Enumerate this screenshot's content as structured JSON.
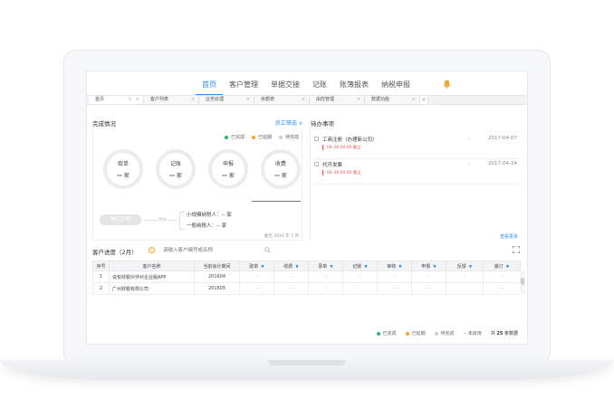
{
  "nav": {
    "items": [
      {
        "label": "首页",
        "active": true
      },
      {
        "label": "客户管理",
        "active": false
      },
      {
        "label": "单据交接",
        "active": false
      },
      {
        "label": "记账",
        "active": false
      },
      {
        "label": "账簿报表",
        "active": false
      },
      {
        "label": "纳税申报",
        "active": false
      }
    ],
    "bell_icon": "bell-icon"
  },
  "tabs": [
    {
      "label": "首页",
      "active": true
    },
    {
      "label": "客户列表",
      "active": false
    },
    {
      "label": "业务处理",
      "active": false
    },
    {
      "label": "余额表",
      "active": false
    },
    {
      "label": "由控管理",
      "active": false
    },
    {
      "label": "数据功能",
      "active": false
    }
  ],
  "overview": {
    "title": "完成情况",
    "staff_filter": "员工筛选 ∨",
    "legend": [
      {
        "label": "已完成",
        "color": "#2bbb5c"
      },
      {
        "label": "已延期",
        "color": "#f5a623"
      },
      {
        "label": "待完成",
        "color": "#cfcfcf"
      }
    ],
    "rings": [
      {
        "label": "取单",
        "value": "--",
        "unit": "家"
      },
      {
        "label": "记账",
        "value": "--",
        "unit": "家"
      },
      {
        "label": "申报",
        "value": "--",
        "unit": "家"
      },
      {
        "label": "收费",
        "value": "--",
        "unit": "家"
      }
    ],
    "start_button": "做完出账",
    "connector_label": "待办",
    "small_taxpayer": "小规模纳税人：-- 家",
    "general_taxpayer": "一般纳税人：-- 家",
    "as_of": "截至 2016 年 2 月"
  },
  "todo": {
    "title": "待办事项",
    "items": [
      {
        "name": "工商注册（办理新公司）",
        "date": "2017-04-07",
        "deadline": "04-28 00:00 截止"
      },
      {
        "name": "代开发票",
        "date": "2017-04-24",
        "deadline": "04-28 00:00 截止"
      }
    ],
    "view_more": "查看更多"
  },
  "progress": {
    "title": "客户进度（2月）",
    "search_placeholder": "请输入客户编号或名称",
    "columns": [
      "序号",
      "客户名称",
      "当前会计期间",
      "取单",
      "收费",
      "录单",
      "记账",
      "审核",
      "申报",
      "反馈",
      "装订"
    ],
    "rows": [
      {
        "no": "1",
        "name": "说有财税伙伴对企业版APP",
        "period": "201604",
        "cells": [
          "--",
          "--",
          "--",
          "--",
          "--",
          "--",
          "--",
          "--"
        ]
      },
      {
        "no": "2",
        "name": "广州财税有限公司",
        "period": "201605",
        "cells": [
          "--",
          "--",
          "--",
          "--",
          "--",
          "--",
          "--",
          "--"
        ]
      }
    ],
    "legend": [
      {
        "label": "已完成",
        "color": "#2bbb5c"
      },
      {
        "label": "已延期",
        "color": "#f5a623"
      },
      {
        "label": "待完成",
        "color": "#cfcfcf"
      },
      {
        "label": "-- 未启用",
        "color": ""
      }
    ],
    "total_prefix": "共",
    "total_count": "25",
    "total_suffix": "条数据"
  }
}
